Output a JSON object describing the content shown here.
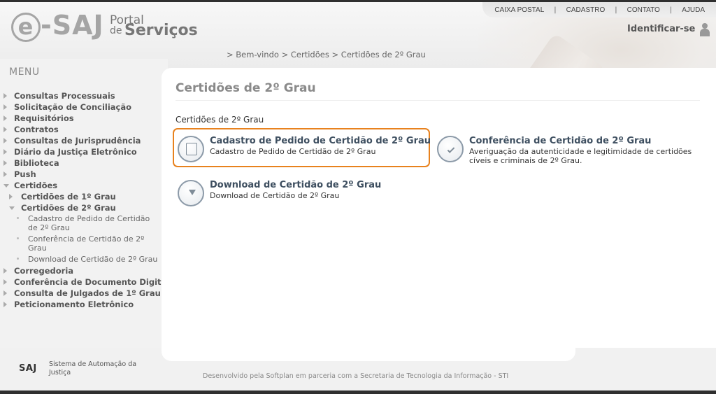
{
  "header": {
    "logo_esaj": "-SAJ",
    "logo_e": "e",
    "logo_portal": "Portal",
    "logo_de": "de",
    "logo_servicos": "Serviços",
    "topnav": [
      "CAIXA POSTAL",
      "CADASTRO",
      "CONTATO",
      "AJUDA"
    ],
    "identify": "Identificar-se"
  },
  "breadcrumb": {
    "items": [
      "Bem-vindo",
      "Certidões",
      "Certidões de 2º Grau"
    ],
    "separator": ">"
  },
  "menu": {
    "title": "MENU",
    "items": [
      {
        "label": "Consultas Processuais"
      },
      {
        "label": "Solicitação de Conciliação"
      },
      {
        "label": "Requisitórios"
      },
      {
        "label": "Contratos"
      },
      {
        "label": "Consultas de Jurisprudência"
      },
      {
        "label": "Diário da Justiça Eletrônico"
      },
      {
        "label": "Biblioteca"
      },
      {
        "label": "Push"
      },
      {
        "label": "Certidões"
      },
      {
        "label": "Certidões de 1º Grau"
      },
      {
        "label": "Certidões de 2º Grau"
      },
      {
        "label": "Cadastro de Pedido de Certidão de 2º Grau"
      },
      {
        "label": "Conferência de Certidão de 2º Grau"
      },
      {
        "label": "Download de Certidão de 2º Grau"
      },
      {
        "label": "Corregedoria"
      },
      {
        "label": "Conferência de Documento Digital"
      },
      {
        "label": "Consulta de Julgados de 1º Grau"
      },
      {
        "label": "Peticionamento Eletrônico"
      }
    ]
  },
  "main": {
    "title": "Certidões de 2º Grau",
    "section_label": "Certidões de 2º Grau",
    "options": [
      {
        "title": "Cadastro de Pedido de Certidão de 2º Grau",
        "desc": "Cadastro de Pedido de Certidão de 2º Grau",
        "icon": "document-edit-icon"
      },
      {
        "title": "Conferência de Certidão de 2º Grau",
        "desc": "Averiguação da autenticidade e legitimidade de certidões cíveis e criminais de 2º Grau.",
        "icon": "document-check-icon"
      },
      {
        "title": "Download de Certidão de 2º Grau",
        "desc": "Download de Certidão de 2º Grau",
        "icon": "document-download-icon"
      }
    ],
    "highlight_color": "#e8821e"
  },
  "footer": {
    "saj_logo": "SAJ",
    "saj_desc": "Sistema de Automação da Justiça",
    "developed_by": "Desenvolvido pela Softplan em parceria com a Secretaria de Tecnologia da Informação - STI"
  }
}
